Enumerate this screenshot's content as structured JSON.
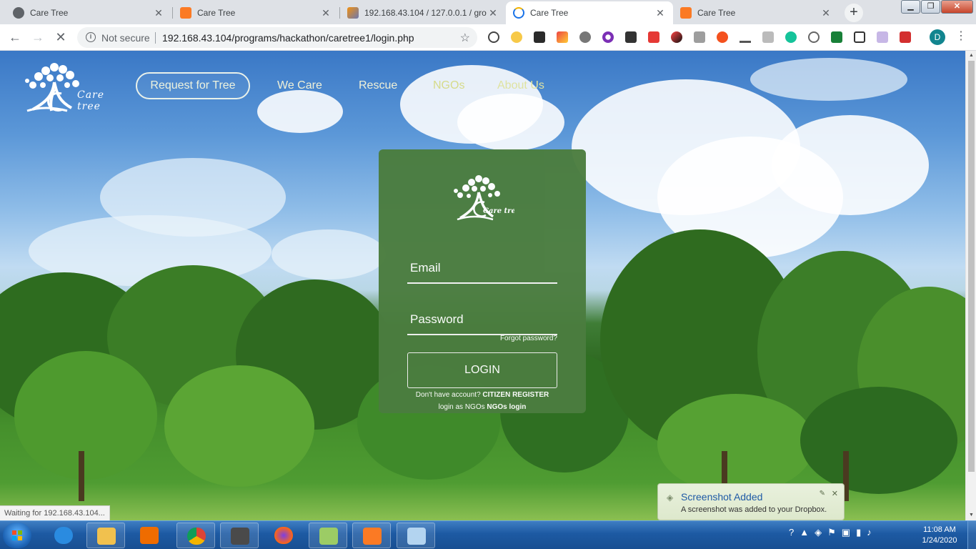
{
  "browser": {
    "tabs": [
      {
        "title": "Care Tree",
        "favicon": "globe-icon",
        "active": false
      },
      {
        "title": "Care Tree",
        "favicon": "xampp-icon",
        "active": false
      },
      {
        "title": "192.168.43.104 / 127.0.0.1 / gro",
        "favicon": "phpmyadmin-icon",
        "active": false
      },
      {
        "title": "Care Tree",
        "favicon": "loading-icon",
        "active": true
      },
      {
        "title": "Care Tree",
        "favicon": "xampp-icon",
        "active": false
      }
    ],
    "security_label": "Not secure",
    "url": "192.168.43.104/programs/hackathon/caretree1/login.php",
    "profile_initial": "D",
    "status_text": "Waiting for 192.168.43.104..."
  },
  "site": {
    "logo_text": "Care tree",
    "nav": {
      "request": "Request for Tree",
      "we_care": "We Care",
      "rescue": "Rescue",
      "ngos": "NGOs",
      "about": "About Us"
    },
    "login": {
      "logo_text": "Care tree",
      "email_placeholder": "Email",
      "password_placeholder": "Password",
      "forgot": "Forgot password?",
      "button": "LOGIN",
      "no_account": "Don't have account?",
      "citizen_register": "CITIZEN REGISTER",
      "ngo_prefix": "login as NGOs",
      "ngo_login": "NGOs login"
    }
  },
  "toast": {
    "title": "Screenshot Added",
    "body": "A screenshot was added to your Dropbox."
  },
  "taskbar": {
    "time": "11:08 AM",
    "date": "1/24/2020"
  },
  "colors": {
    "card": "#4b7d3f",
    "accent_link": "#1f5aa6"
  }
}
